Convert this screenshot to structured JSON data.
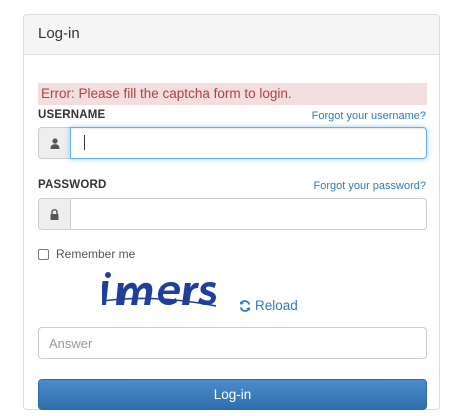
{
  "panel": {
    "title": "Log-in"
  },
  "error": {
    "message": "Error: Please fill the captcha form to login."
  },
  "username": {
    "label": "USERNAME",
    "forgot_link": "Forgot your username?",
    "value": "",
    "icon": "user-icon"
  },
  "password": {
    "label": "PASSWORD",
    "forgot_link": "Forgot your password?",
    "value": "",
    "icon": "lock-icon"
  },
  "remember": {
    "label": "Remember me",
    "checked": false
  },
  "captcha": {
    "image_text": "imers",
    "reload_label": "Reload",
    "reload_icon": "refresh-icon"
  },
  "answer": {
    "placeholder": "Answer",
    "value": ""
  },
  "submit": {
    "label": "Log-in"
  },
  "colors": {
    "link": "#337ab7",
    "error_bg": "#f2dede",
    "error_text": "#a94442",
    "button": "#337ab7",
    "captcha": "#1f3f9a"
  }
}
